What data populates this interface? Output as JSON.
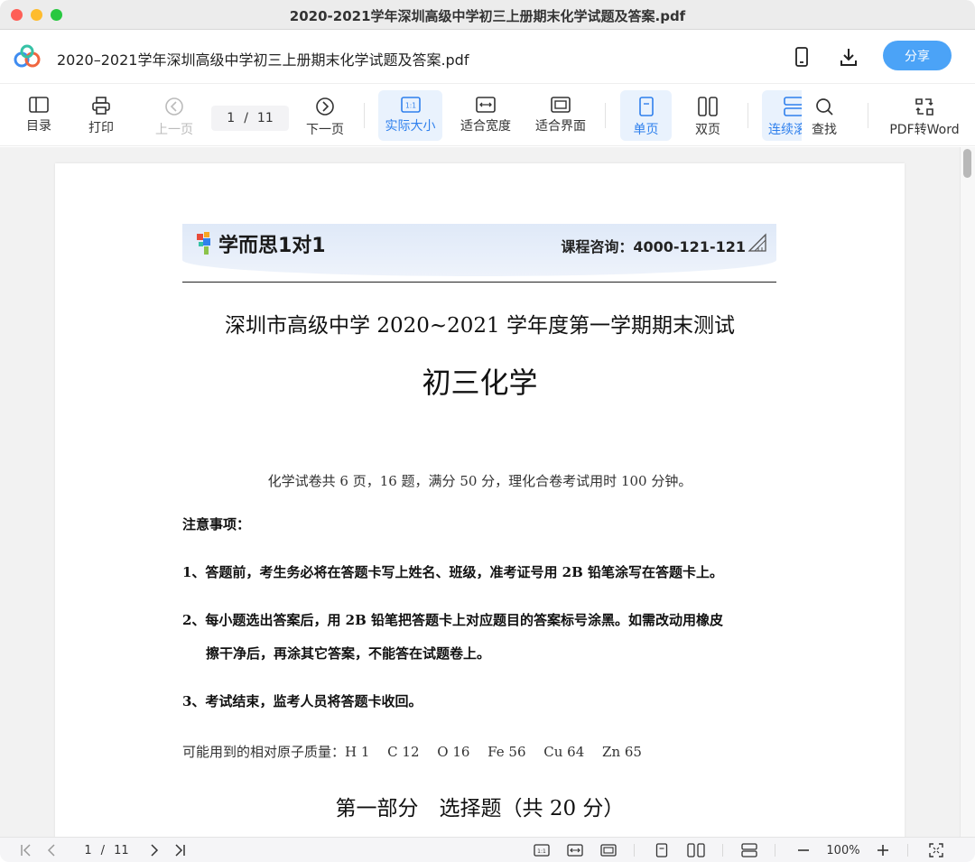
{
  "window": {
    "title": "2020-2021学年深圳高级中学初三上册期末化学试题及答案.pdf"
  },
  "appbar": {
    "doc_name": "2020–2021学年深圳高级中学初三上册期末化学试题及答案.pdf",
    "share_label": "分享",
    "icons": [
      "mobile-icon",
      "download-icon"
    ]
  },
  "toolbar": {
    "toc": "目录",
    "print": "打印",
    "prev_page": "上一页",
    "page_current": "1",
    "page_sep": "/",
    "page_total": "11",
    "next_page": "下一页",
    "actual_size": "实际大小",
    "fit_width": "适合宽度",
    "fit_page": "适合界面",
    "single_page": "单页",
    "double_page": "双页",
    "continuous": "连续滚",
    "find": "查找",
    "pdf_to_word": "PDF转Word",
    "actual_size_glyph": "1:1",
    "active_color": "#2f80ed"
  },
  "document": {
    "brand_name": "学而思1对1",
    "hotline": "课程咨询：4000-121-121",
    "exam_title": "深圳市高级中学 2020~2021 学年度第一学期期末测试",
    "exam_subject": "初三化学",
    "exam_info": "化学试卷共 6 页，16 题，满分 50 分，理化合卷考试用时 100 分钟。",
    "notes_heading": "注意事项：",
    "note1": "1、答题前，考生务必将在答题卡写上姓名、班级，准考证号用 2B 铅笔涂写在答题卡上。",
    "note2_line1": "2、每小题选出答案后，用 2B 铅笔把答题卡上对应题目的答案标号涂黑。如需改动用橡皮",
    "note2_line2": "擦干净后，再涂其它答案，不能答在试题卷上。",
    "note3": "3、考试结束，监考人员将答题卡收回。",
    "atomic_masses": "可能用到的相对原子质量：H 1　 C 12　 O 16　 Fe 56　 Cu 64　 Zn 65",
    "part1_title": "第一部分　选择题（共 20 分）"
  },
  "bottombar": {
    "page_current": "1",
    "page_sep": "/",
    "page_total": "11",
    "zoom": "100%",
    "actual_size_glyph": "1:1"
  }
}
